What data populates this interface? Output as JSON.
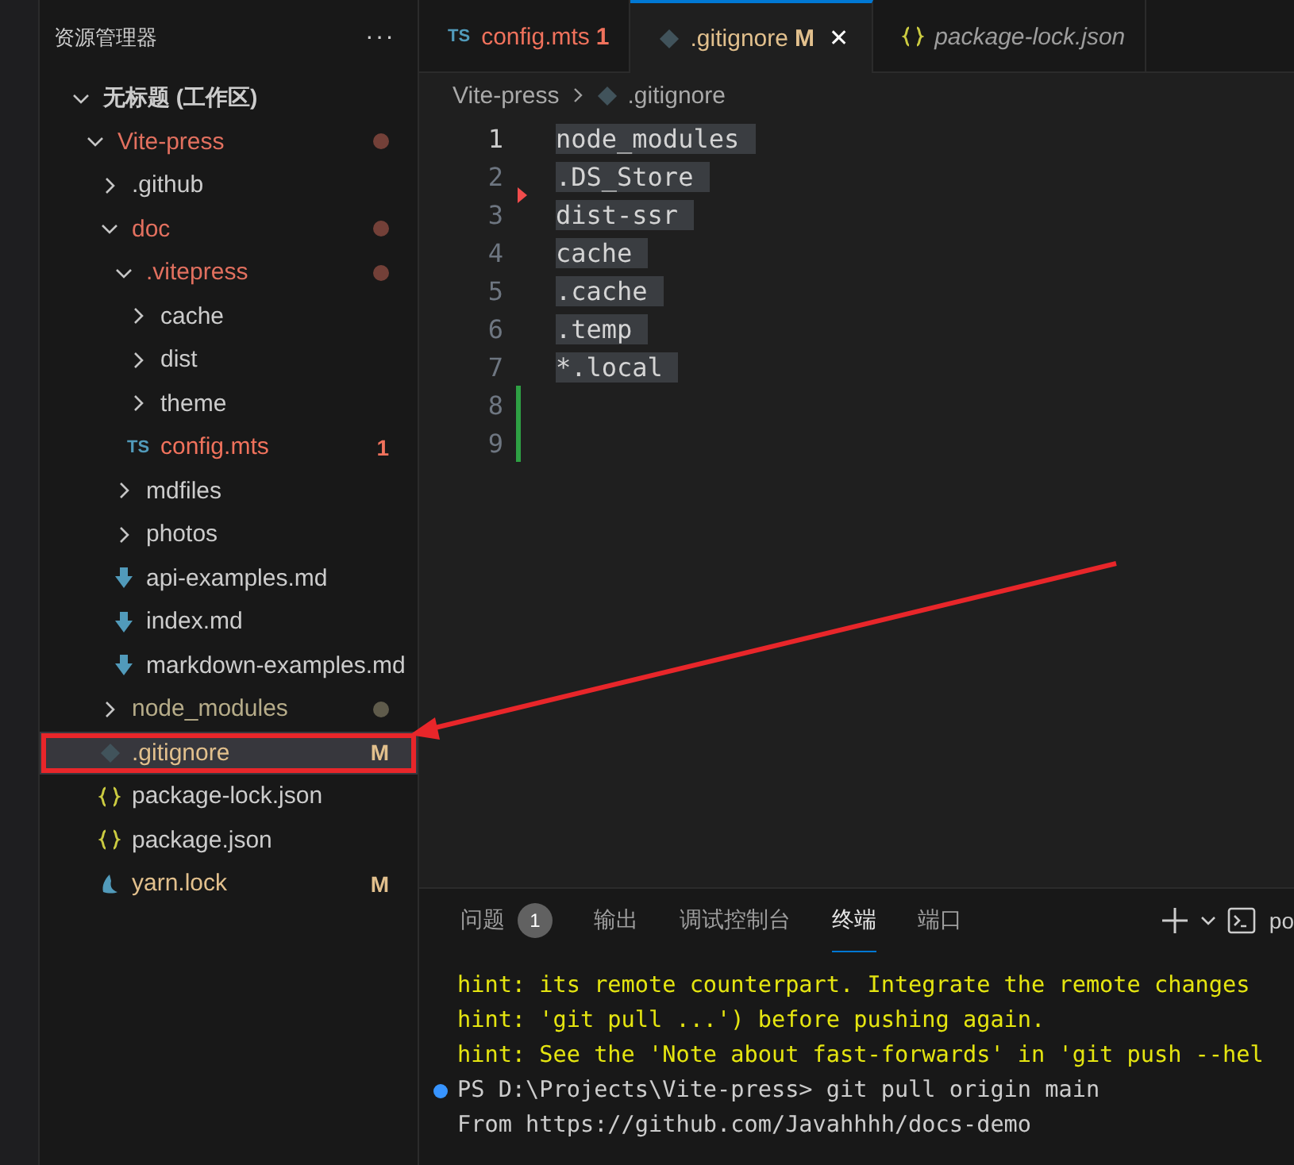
{
  "explorer": {
    "title": "资源管理器",
    "more": "···",
    "tree": [
      {
        "name": "无标题 (工作区)",
        "kind": "workspace",
        "expanded": true,
        "children": [
          {
            "name": "Vite-press",
            "kind": "folder",
            "expanded": true,
            "color": "#e2705f",
            "dot": true,
            "children": [
              {
                "name": ".github",
                "kind": "folder",
                "expanded": false
              },
              {
                "name": "doc",
                "kind": "folder",
                "expanded": true,
                "color": "#e2705f",
                "dot": true,
                "children": [
                  {
                    "name": ".vitepress",
                    "kind": "folder",
                    "expanded": true,
                    "color": "#e2705f",
                    "dot": true,
                    "children": [
                      {
                        "name": "cache",
                        "kind": "folder",
                        "expanded": false
                      },
                      {
                        "name": "dist",
                        "kind": "folder",
                        "expanded": false
                      },
                      {
                        "name": "theme",
                        "kind": "folder",
                        "expanded": false
                      },
                      {
                        "name": "config.mts",
                        "kind": "ts",
                        "icon_text": "TS",
                        "color": "#f0725c",
                        "badge": "1"
                      }
                    ]
                  },
                  {
                    "name": "mdfiles",
                    "kind": "folder",
                    "expanded": false
                  },
                  {
                    "name": "photos",
                    "kind": "folder",
                    "expanded": false
                  },
                  {
                    "name": "api-examples.md",
                    "kind": "markdown"
                  },
                  {
                    "name": "index.md",
                    "kind": "markdown"
                  },
                  {
                    "name": "markdown-examples.md",
                    "kind": "markdown"
                  }
                ]
              },
              {
                "name": "node_modules",
                "kind": "folder",
                "expanded": false,
                "color": "#b6ac89",
                "dot": true
              },
              {
                "name": ".gitignore",
                "kind": "git",
                "color": "#e2c08d",
                "badge": "M",
                "selected": true,
                "highlighted": true
              },
              {
                "name": "package-lock.json",
                "kind": "json",
                "selected": false
              },
              {
                "name": "package.json",
                "kind": "json",
                "selected": false
              },
              {
                "name": "yarn.lock",
                "kind": "yarn",
                "color": "#e2c08d",
                "badge": "M",
                "selected": false
              }
            ]
          }
        ]
      }
    ]
  },
  "tabs": [
    {
      "label": "config.mts",
      "kind": "ts",
      "icon_text": "TS",
      "color": "#f0725c",
      "badge": "1",
      "selected": false,
      "preview": false
    },
    {
      "label": ".gitignore",
      "kind": "git",
      "color": "#e2c08d",
      "badge": "M",
      "selected": true,
      "preview": false,
      "close": "✕"
    },
    {
      "label": "package-lock.json",
      "kind": "json",
      "selected": false,
      "preview": true
    }
  ],
  "breadcrumb": [
    {
      "label": "Vite-press",
      "kind": "folder"
    },
    {
      "label": ".gitignore",
      "kind": "git"
    }
  ],
  "editor": {
    "lines": [
      {
        "number": "1",
        "text": "node_modules",
        "current": true,
        "added": false,
        "deleted_above": false
      },
      {
        "number": "2",
        "text": ".DS_Store",
        "current": false,
        "added": false,
        "deleted_above": false
      },
      {
        "number": "3",
        "text": "dist-ssr",
        "current": false,
        "added": false,
        "deleted_above": true
      },
      {
        "number": "4",
        "text": "cache",
        "current": false,
        "added": false,
        "deleted_above": false
      },
      {
        "number": "5",
        "text": ".cache",
        "current": false,
        "added": false,
        "deleted_above": false
      },
      {
        "number": "6",
        "text": ".temp",
        "current": false,
        "added": false,
        "deleted_above": false
      },
      {
        "number": "7",
        "text": "*.local",
        "current": false,
        "added": false,
        "deleted_above": false
      },
      {
        "number": "8",
        "current": false,
        "added": true,
        "deleted_above": false
      },
      {
        "number": "9",
        "current": false,
        "added": true,
        "deleted_above": false
      }
    ]
  },
  "panel": {
    "tabs": [
      {
        "label": "问题",
        "badge": "1",
        "selected": false
      },
      {
        "label": "输出",
        "selected": false
      },
      {
        "label": "调试控制台",
        "selected": false
      },
      {
        "label": "终端",
        "selected": true
      },
      {
        "label": "端口",
        "selected": false
      }
    ],
    "shell_label": "po",
    "terminal": [
      {
        "kind": "hint",
        "text": "hint: its remote counterpart. Integrate the remote changes"
      },
      {
        "kind": "hint",
        "text": "hint: 'git pull ...') before pushing again."
      },
      {
        "kind": "hint",
        "text": "hint: See the 'Note about fast-forwards' in 'git push --hel"
      },
      {
        "kind": "prompt",
        "text": "PS D:\\Projects\\Vite-press> git pull origin main"
      },
      {
        "kind": "plain",
        "text": "From https://github.com/Javahhhh/docs-demo"
      }
    ]
  }
}
